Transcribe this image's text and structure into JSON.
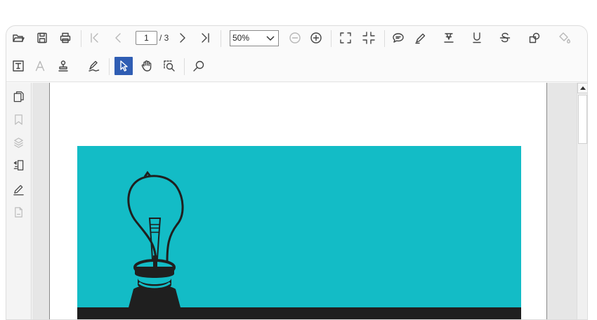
{
  "navigation": {
    "current_page": "1",
    "total_pages": "/ 3"
  },
  "zoom": {
    "value": "50%",
    "options": [
      "50%"
    ]
  },
  "document": {
    "hero_background_color": "#13bcc6",
    "strip_color": "#1f1f1f",
    "illustration": "light-bulb"
  },
  "colors": {
    "accent_active": "#2f5db3",
    "icon_default": "#444444",
    "icon_disabled": "#b8b8b8"
  },
  "toolbar_icons": [
    "open-icon",
    "save-icon",
    "print-icon",
    "first-page-icon",
    "previous-page-icon",
    "next-page-icon",
    "last-page-icon",
    "zoom-out-icon",
    "zoom-in-icon",
    "fit-page-icon",
    "fit-width-icon",
    "comment-icon",
    "ink-icon",
    "highlight-icon",
    "underline-icon",
    "strikethrough-icon",
    "shapes-icon",
    "fill-icon",
    "text-box-icon",
    "font-icon",
    "stamp-icon",
    "signature-icon",
    "select-tool-icon",
    "pan-tool-icon",
    "marquee-zoom-icon",
    "search-icon"
  ],
  "sidebar_icons": [
    "pages-thumbnail-icon",
    "bookmark-icon",
    "layers-icon",
    "page-tools-icon",
    "annotation-pen-icon",
    "document-icon"
  ]
}
